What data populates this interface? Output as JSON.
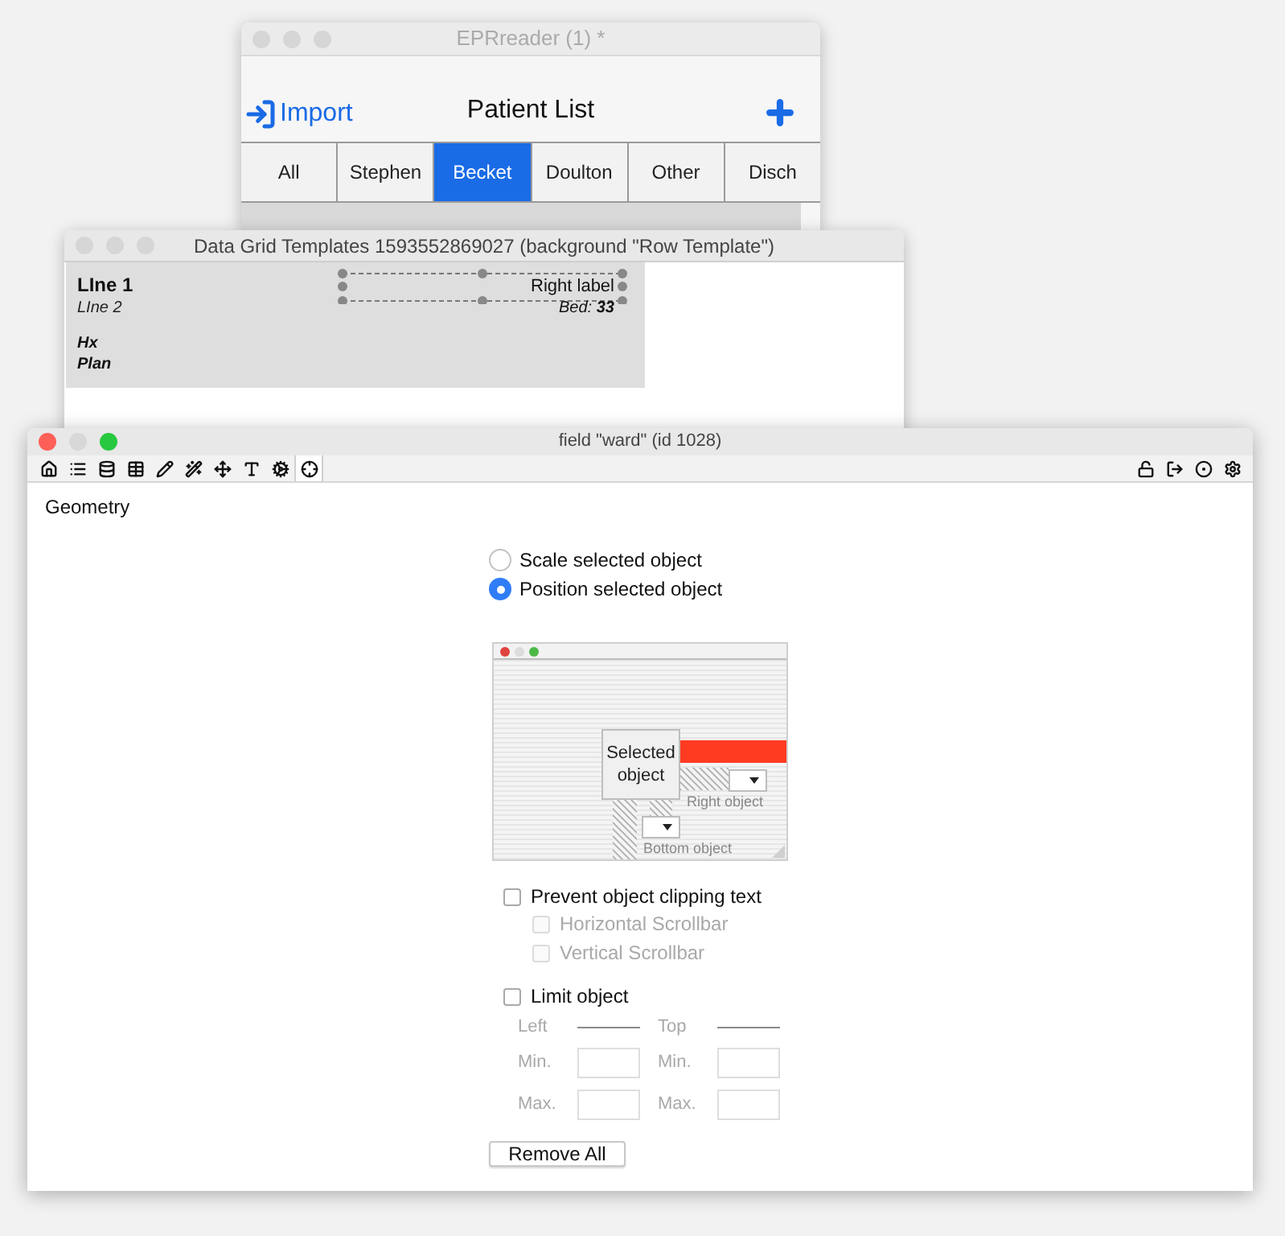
{
  "patient_window": {
    "title": "EPRreader (1) *",
    "active": false,
    "import_label": "Import",
    "heading": "Patient List",
    "tabs": [
      {
        "label": "All",
        "selected": false
      },
      {
        "label": "Stephen",
        "selected": false
      },
      {
        "label": "Becket",
        "selected": true
      },
      {
        "label": "Doulton",
        "selected": false
      },
      {
        "label": "Other",
        "selected": false
      },
      {
        "label": "Disch",
        "selected": false
      }
    ]
  },
  "template_window": {
    "title": "Data Grid Templates 1593552869027 (background \"Row Template\")",
    "active": false,
    "line_1": "LIne 1",
    "line_2": "LIne 2",
    "labels": [
      "Hx",
      "Plan"
    ],
    "right_label": "Right label",
    "bed": "Bed: **33**"
  },
  "inspector": {
    "title": "field \"ward\" (id 1028)",
    "active": true,
    "toolbar": [
      {
        "kind": "home",
        "selected": false
      },
      {
        "kind": "list",
        "selected": false
      },
      {
        "kind": "database",
        "selected": false
      },
      {
        "kind": "table",
        "selected": false
      },
      {
        "kind": "pencil",
        "selected": false
      },
      {
        "kind": "wand",
        "selected": false
      },
      {
        "kind": "move",
        "selected": false
      },
      {
        "kind": "text",
        "selected": false
      },
      {
        "kind": "gears",
        "selected": false
      },
      {
        "kind": "geometry",
        "selected": true
      }
    ],
    "toolbar_right": [
      {
        "kind": "unlock"
      },
      {
        "kind": "enter"
      },
      {
        "kind": "target"
      },
      {
        "kind": "settings"
      }
    ],
    "section": "Geometry",
    "mode_options": [
      {
        "label": "Scale selected object",
        "selected": false
      },
      {
        "label": "Position selected object",
        "selected": true
      }
    ],
    "diagram": {
      "selected_label": "Selected object",
      "right_label": "Right object",
      "bottom_label": "Bottom object"
    },
    "prevent_clipping": {
      "label": "Prevent object clipping text",
      "checked": false,
      "sub_options": [
        {
          "label": "Horizontal Scrollbar",
          "checked": false,
          "disabled": true
        },
        {
          "label": "Vertical Scrollbar",
          "checked": false,
          "disabled": true
        }
      ]
    },
    "limit": {
      "label": "Limit object",
      "checked": false,
      "columns": [
        {
          "heading": "Left",
          "min_label": "Min.",
          "max_label": "Max."
        },
        {
          "heading": "Top",
          "min_label": "Min.",
          "max_label": "Max."
        }
      ]
    },
    "remove_button": "Remove All"
  }
}
